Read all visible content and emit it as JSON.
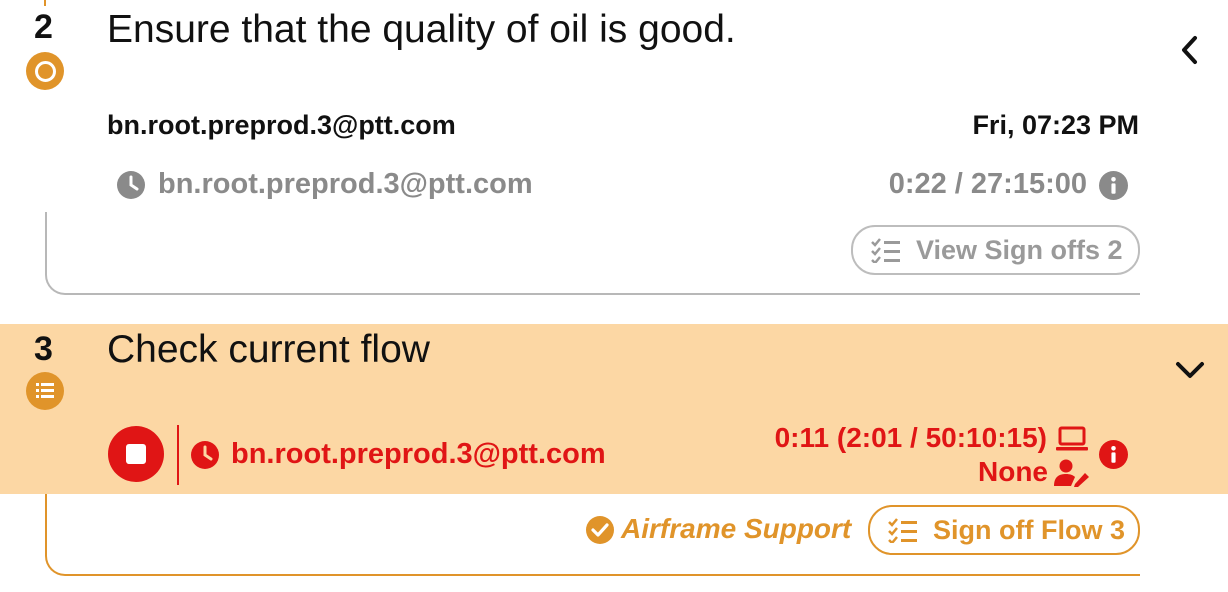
{
  "colors": {
    "accent_orange": "#E0942A",
    "active_background": "#FCD7A4",
    "stop_red": "#E01515",
    "muted_grey": "#8A8A8A"
  },
  "steps": [
    {
      "number": "2",
      "title": "Ensure that the quality of oil is good.",
      "status_icon": "circle-outline-icon",
      "user": "bn.root.preprod.3@ptt.com",
      "date": "Fri, 07:23 PM",
      "history_user": "bn.root.preprod.3@ptt.com",
      "duration": "0:22 / 27:15:00",
      "signoff_button": "View Sign offs 2",
      "collapse_icon": "chevron-left-icon"
    },
    {
      "number": "3",
      "title": "Check current flow",
      "status_icon": "numbered-list-icon",
      "active_user": "bn.root.preprod.3@ptt.com",
      "timer": "0:11 (2:01 / 50:10:15)",
      "assignee": "None",
      "role": "Airframe Support",
      "signoff_button": "Sign off Flow 3",
      "collapse_icon": "chevron-down-icon"
    }
  ]
}
